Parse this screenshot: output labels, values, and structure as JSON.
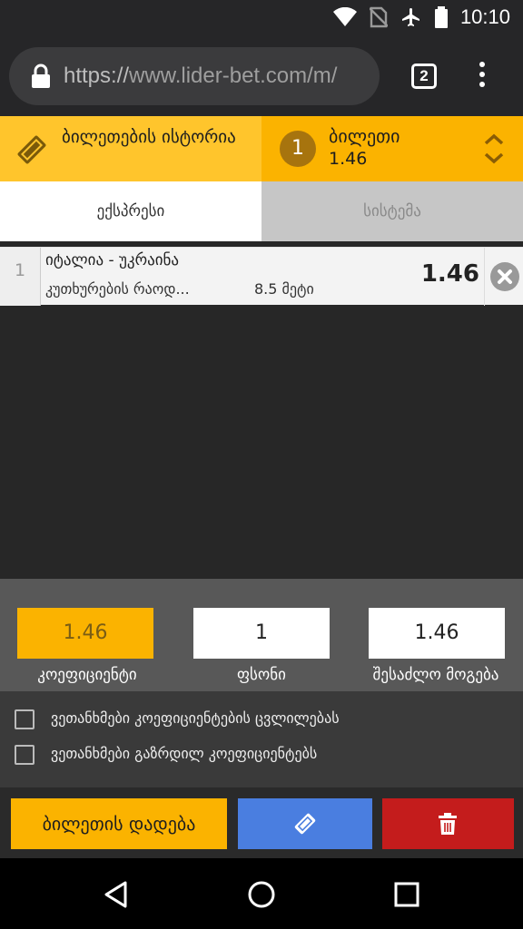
{
  "status_bar": {
    "time": "10:10"
  },
  "browser": {
    "url_protocol": "https://",
    "url_rest": "www.lider-bet.com/m/",
    "tab_count": "2"
  },
  "header": {
    "history_label": "ბილეთების ისტორია",
    "ticket_count": "1",
    "ticket_title": "ბილეთი",
    "ticket_odds": "1.46"
  },
  "subtabs": {
    "express": "ექსპრესი",
    "system": "სისტემა"
  },
  "bet": {
    "index": "1",
    "teams": "იტალია - უკრაინა",
    "market": "კუთხურების რაოდ...",
    "market_value": "8.5 მეტი",
    "odds": "1.46"
  },
  "stake_panel": {
    "coefficient_value": "1.46",
    "coefficient_label": "კოეფიციენტი",
    "stake_value": "1",
    "stake_label": "ფსონი",
    "win_value": "1.46",
    "win_label": "შესაძლო მოგება"
  },
  "options": {
    "accept_changes": "ვეთანხმები კოეფიციენტების ცვლილებას",
    "accept_increased": "ვეთანხმები გაზრდილ კოეფიციენტებს"
  },
  "actions": {
    "place_bet": "ბილეთის დადება"
  },
  "colors": {
    "accent": "#fbb300",
    "save": "#4a7ee0",
    "delete": "#c41c1c"
  }
}
